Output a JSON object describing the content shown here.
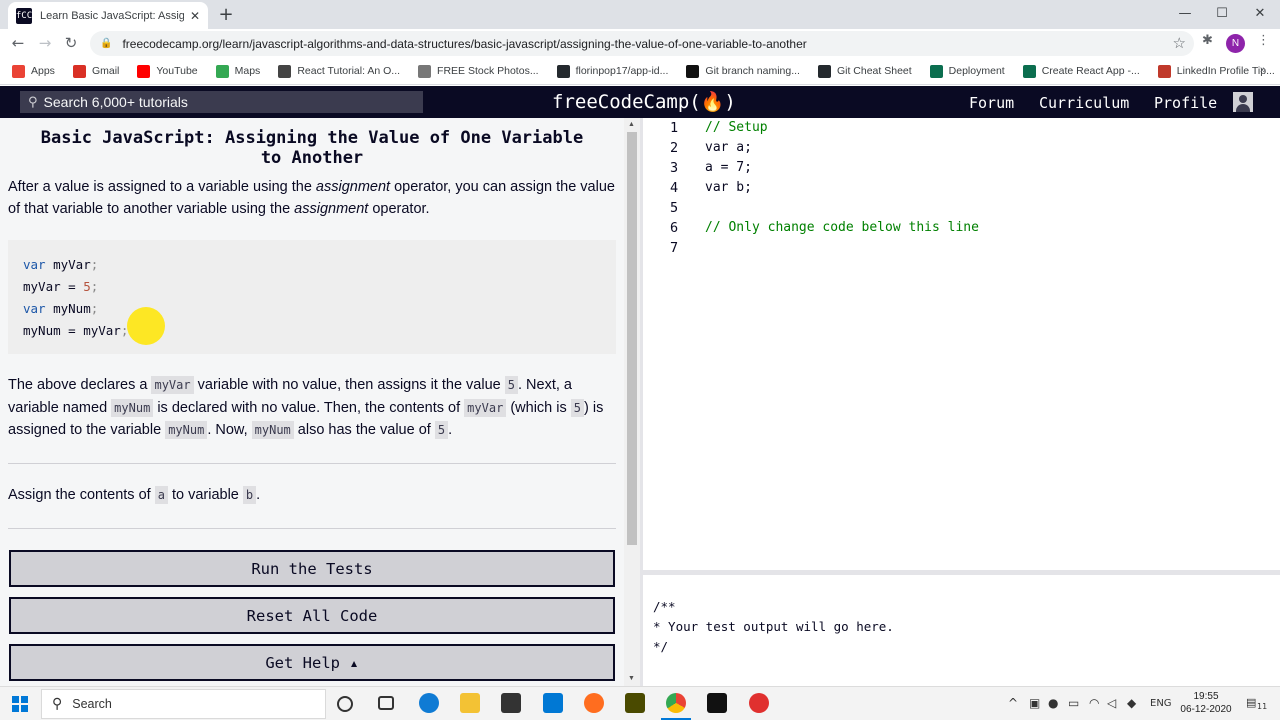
{
  "browser": {
    "tab_title": "Learn Basic JavaScript: Assigning",
    "tab_favicon": "fCC",
    "url": "freecodecamp.org/learn/javascript-algorithms-and-data-structures/basic-javascript/assigning-the-value-of-one-variable-to-another",
    "profile_initial": "N",
    "bookmarks": [
      {
        "label": "Apps",
        "color": "#ea4335"
      },
      {
        "label": "Gmail",
        "color": "#d93025"
      },
      {
        "label": "YouTube",
        "color": "#ff0000"
      },
      {
        "label": "Maps",
        "color": "#34a853"
      },
      {
        "label": "React Tutorial: An O...",
        "color": "#444444"
      },
      {
        "label": "FREE Stock Photos...",
        "color": "#777777"
      },
      {
        "label": "florinpop17/app-id...",
        "color": "#24292e"
      },
      {
        "label": "Git branch naming...",
        "color": "#111111"
      },
      {
        "label": "Git Cheat Sheet",
        "color": "#24292e"
      },
      {
        "label": "Deployment",
        "color": "#0b6e4f"
      },
      {
        "label": "Create React App -...",
        "color": "#0b6e4f"
      },
      {
        "label": "LinkedIn Profile Tip...",
        "color": "#c0392b"
      }
    ]
  },
  "nav": {
    "search_placeholder": "Search 6,000+ tutorials",
    "logo": "freeCodeCamp(🔥)",
    "links": [
      "Forum",
      "Curriculum",
      "Profile"
    ]
  },
  "challenge": {
    "title": "Basic JavaScript: Assigning the Value of One Variable to Another",
    "intro_1": "After a value is assigned to a variable using the ",
    "intro_em_1": "assignment",
    "intro_2": " operator, you can assign the value of that variable to another variable using the ",
    "intro_em_2": "assignment",
    "intro_3": " operator.",
    "example_lines": [
      {
        "kw": "var",
        "name": " myVar",
        "tail": ";"
      },
      {
        "kw": "",
        "name": "myVar = ",
        "num": "5",
        "tail": ";"
      },
      {
        "kw": "var",
        "name": " myNum",
        "tail": ";"
      },
      {
        "kw": "",
        "name": "myNum = myVar",
        "tail": ";"
      }
    ],
    "expl": {
      "t1": "The above declares a ",
      "c1": "myVar",
      "t2": " variable with no value, then assigns it the value ",
      "c2": "5",
      "t3": ". Next, a variable named ",
      "c3": "myNum",
      "t4": " is declared with no value. Then, the contents of ",
      "c4": "myVar",
      "t5": " (which is ",
      "c5": "5",
      "t6": ") is assigned to the variable ",
      "c6": "myNum",
      "t7": ". Now, ",
      "c7": "myNum",
      "t8": " also has the value of ",
      "c8": "5",
      "t9": "."
    },
    "task": {
      "t1": "Assign the contents of ",
      "c1": "a",
      "t2": " to variable ",
      "c2": "b",
      "t3": "."
    },
    "buttons": {
      "run": "Run the Tests",
      "reset": "Reset All Code",
      "help": "Get Help ▴"
    }
  },
  "editor": {
    "lines": [
      {
        "n": "1",
        "text": "// Setup",
        "comment": true
      },
      {
        "n": "2",
        "text": "var a;",
        "comment": false
      },
      {
        "n": "3",
        "text": "a = 7;",
        "comment": false
      },
      {
        "n": "4",
        "text": "var b;",
        "comment": false
      },
      {
        "n": "5",
        "text": "",
        "comment": false
      },
      {
        "n": "6",
        "text": "// Only change code below this line",
        "comment": true
      },
      {
        "n": "7",
        "text": "",
        "comment": false
      }
    ],
    "console_text": "/**\n* Your test output will go here.\n*/"
  },
  "taskbar": {
    "search_label": "Search",
    "lang": "ENG",
    "time": "19:55",
    "date": "06-12-2020",
    "notification_count": "11"
  }
}
